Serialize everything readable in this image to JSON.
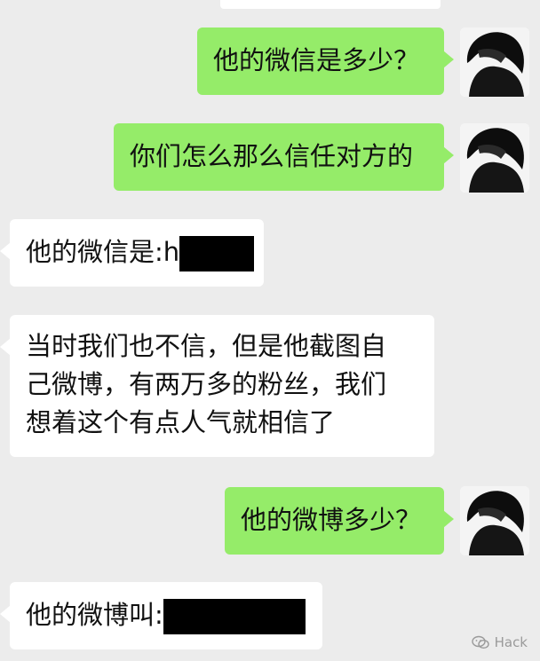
{
  "messages": [
    {
      "sender": "me",
      "text": "他的微信是多少？"
    },
    {
      "sender": "me",
      "text": "你们怎么那么信任对方的"
    },
    {
      "sender": "other",
      "text": "他的微信是:h",
      "redacted": true
    },
    {
      "sender": "other",
      "lines": [
        "当时我们也不信，但是他截图自",
        "己微博，有两万多的粉丝，我们",
        "想着这个有点人气就相信了"
      ]
    },
    {
      "sender": "me",
      "text": "他的微博多少？"
    },
    {
      "sender": "other",
      "text": "他的微博叫:",
      "redacted": true
    }
  ],
  "watermark": {
    "text": "Hack",
    "icon": "wechat-icon"
  },
  "colors": {
    "sent_bubble": "#95ec69",
    "received_bubble": "#ffffff",
    "background": "#ececec",
    "redaction": "#000000"
  }
}
